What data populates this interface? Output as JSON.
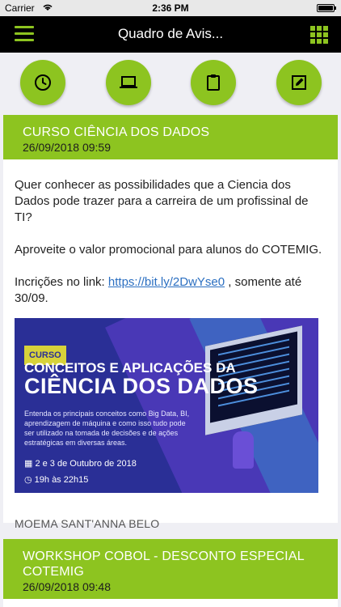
{
  "status_bar": {
    "carrier": "Carrier",
    "time": "2:36 PM"
  },
  "navbar": {
    "title": "Quadro de Avis..."
  },
  "action_buttons": [
    {
      "icon": "clock-icon"
    },
    {
      "icon": "laptop-icon"
    },
    {
      "icon": "clipboard-icon"
    },
    {
      "icon": "edit-icon"
    }
  ],
  "cards": [
    {
      "title": "CURSO CIÊNCIA DOS DADOS",
      "date": "26/09/2018 09:59",
      "p1": "Quer conhecer as possibilidades que a Ciencia dos Dados pode trazer para a carreira de um profissinal de TI?",
      "p2": "Aproveite o valor promocional para alunos do COTEMIG.",
      "p3_prefix": "Incrições no link: ",
      "p3_link": "https://bit.ly/2DwYse0",
      "p3_suffix": " , somente até 30/09.",
      "banner": {
        "tag": "CURSO",
        "line1": "CONCEITOS E APLICAÇÕES DA",
        "line2": "CIÊNCIA DOS DADOS",
        "desc": "Entenda os principais conceitos como Big Data, BI, aprendizagem de máquina e como isso tudo pode ser utilizado na tomada de decisões e de ações estratégicas em diversas áreas.",
        "date": "2 e 3 de Outubro de 2018",
        "hours": "19h às 22h15"
      },
      "author": "MOEMA SANT'ANNA BELO"
    },
    {
      "title": "WORKSHOP COBOL - DESCONTO ESPECIAL COTEMIG",
      "date": "26/09/2018 09:48"
    }
  ],
  "colors": {
    "accent": "#8dc420",
    "navbar": "#000000",
    "link": "#2b6fc1"
  }
}
